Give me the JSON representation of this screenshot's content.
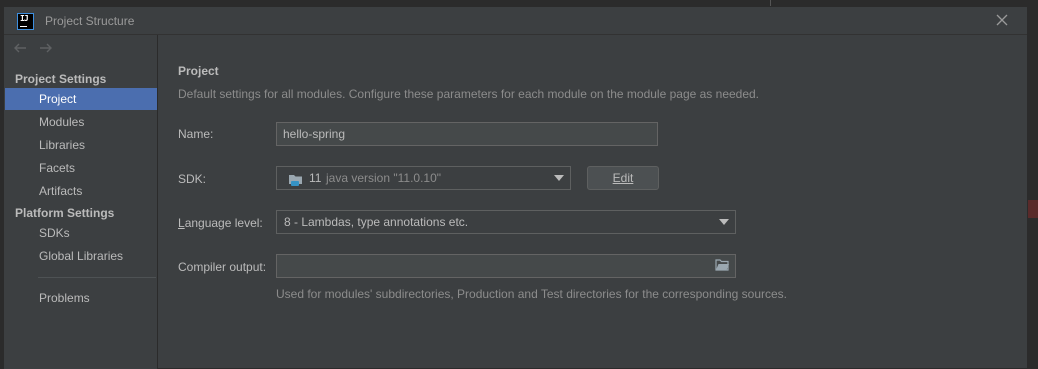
{
  "window": {
    "title": "Project Structure",
    "app_icon_text": "IJ"
  },
  "sidebar": {
    "sections": [
      {
        "title": "Project Settings",
        "items": [
          "Project",
          "Modules",
          "Libraries",
          "Facets",
          "Artifacts"
        ]
      },
      {
        "title": "Platform Settings",
        "items": [
          "SDKs",
          "Global Libraries"
        ]
      }
    ],
    "problems_label": "Problems",
    "selected_item": "Project"
  },
  "main": {
    "title": "Project",
    "description": "Default settings for all modules. Configure these parameters for each module on the module page as needed.",
    "name": {
      "label": "Name:",
      "value": "hello-spring"
    },
    "sdk": {
      "label": "SDK:",
      "number": "11",
      "version": "java version \"11.0.10\"",
      "edit_button": "Edit"
    },
    "language_level": {
      "label_prefix": "",
      "label_underlined": "L",
      "label_rest": "anguage level:",
      "value": "8 - Lambdas, type annotations etc."
    },
    "compiler_output": {
      "label": "Compiler output:",
      "value": "",
      "hint": "Used for modules' subdirectories, Production and Test directories for the corresponding sources."
    }
  },
  "colors": {
    "selection": "#4b6eaf",
    "panel": "#3c3f41",
    "field": "#45494a",
    "text": "#bbbbbb",
    "muted": "#8c8c8c"
  }
}
